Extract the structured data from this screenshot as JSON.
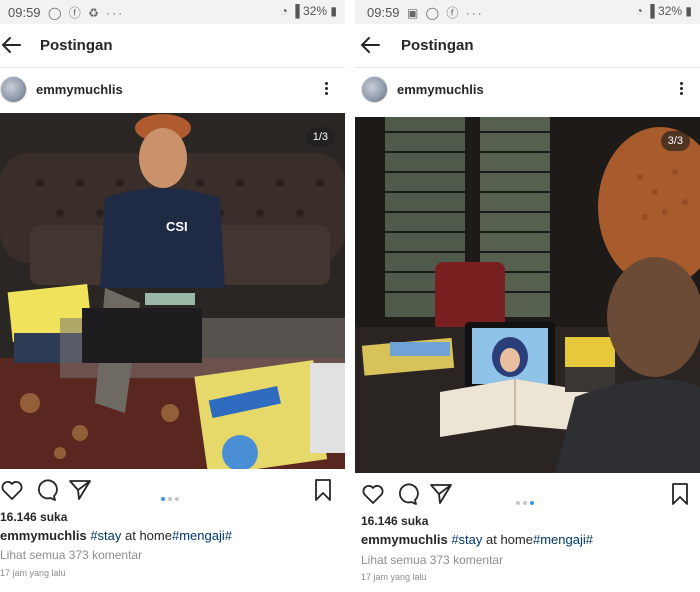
{
  "posts": [
    {
      "status": {
        "time": "09:59",
        "icons": "◯ ⓕ ♻  ···",
        "battery": "32%"
      },
      "appbar": {
        "title": "Postingan"
      },
      "user": {
        "name": "emmymuchlis"
      },
      "photo": {
        "counter": "1/3"
      },
      "likes": "16.146 suka",
      "caption": {
        "user": "emmymuchlis",
        "text1": " #stay",
        "text2": " at home",
        "text3": "#mengaji#"
      },
      "comments": "Lihat semua 373 komentar",
      "time_ago": "17 jam yang lalu"
    },
    {
      "status": {
        "time": "09:59",
        "icons": "▣ ◯ ⓕ  ···",
        "battery": "32%"
      },
      "appbar": {
        "title": "Postingan"
      },
      "user": {
        "name": "emmymuchlis"
      },
      "photo": {
        "counter": "3/3"
      },
      "likes": "16.146 suka",
      "caption": {
        "user": "emmymuchlis",
        "text1": " #stay",
        "text2": " at home",
        "text3": "#mengaji#"
      },
      "comments": "Lihat semua 373 komentar",
      "time_ago": "17 jam yang lalu"
    }
  ],
  "colors": {
    "link": "#00376b",
    "active_dot": "#3897f0",
    "muted": "#8e8e8e"
  },
  "icons": [
    "back-arrow-icon",
    "more-vertical-icon",
    "heart-icon",
    "comment-icon",
    "share-icon",
    "bookmark-icon",
    "wifi-icon",
    "signal-icon",
    "battery-icon"
  ]
}
